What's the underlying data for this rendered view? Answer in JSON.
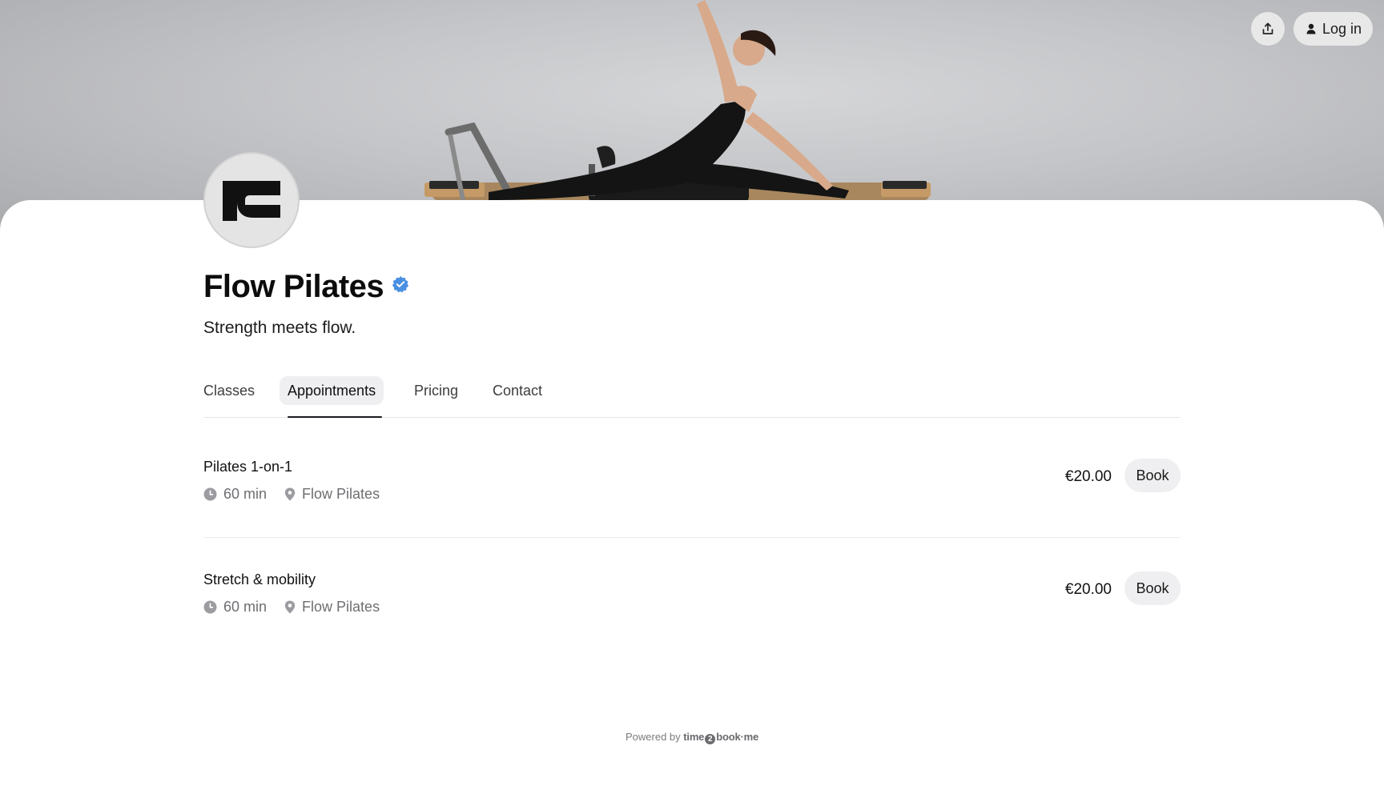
{
  "header": {
    "share_icon": "share-upload-icon",
    "login_icon": "user-icon",
    "login_label": "Log in"
  },
  "profile": {
    "name": "Flow Pilates",
    "verified_icon": "verified-check-icon",
    "tagline": "Strength meets flow."
  },
  "tabs": [
    {
      "label": "Classes",
      "active": false
    },
    {
      "label": "Appointments",
      "active": true
    },
    {
      "label": "Pricing",
      "active": false
    },
    {
      "label": "Contact",
      "active": false
    }
  ],
  "services": [
    {
      "name": "Pilates 1-on-1",
      "duration": "60 min",
      "location": "Flow Pilates",
      "price": "€20.00",
      "button": "Book"
    },
    {
      "name": "Stretch & mobility",
      "duration": "60 min",
      "location": "Flow Pilates",
      "price": "€20.00",
      "button": "Book"
    }
  ],
  "footer": {
    "prefix": "Powered by",
    "brand_a": "time",
    "brand_num": "2",
    "brand_b": "book·me"
  },
  "colors": {
    "verified": "#4a90e2",
    "text_primary": "#111111",
    "text_muted": "#6e6e72",
    "pill_bg": "#efeff1"
  }
}
